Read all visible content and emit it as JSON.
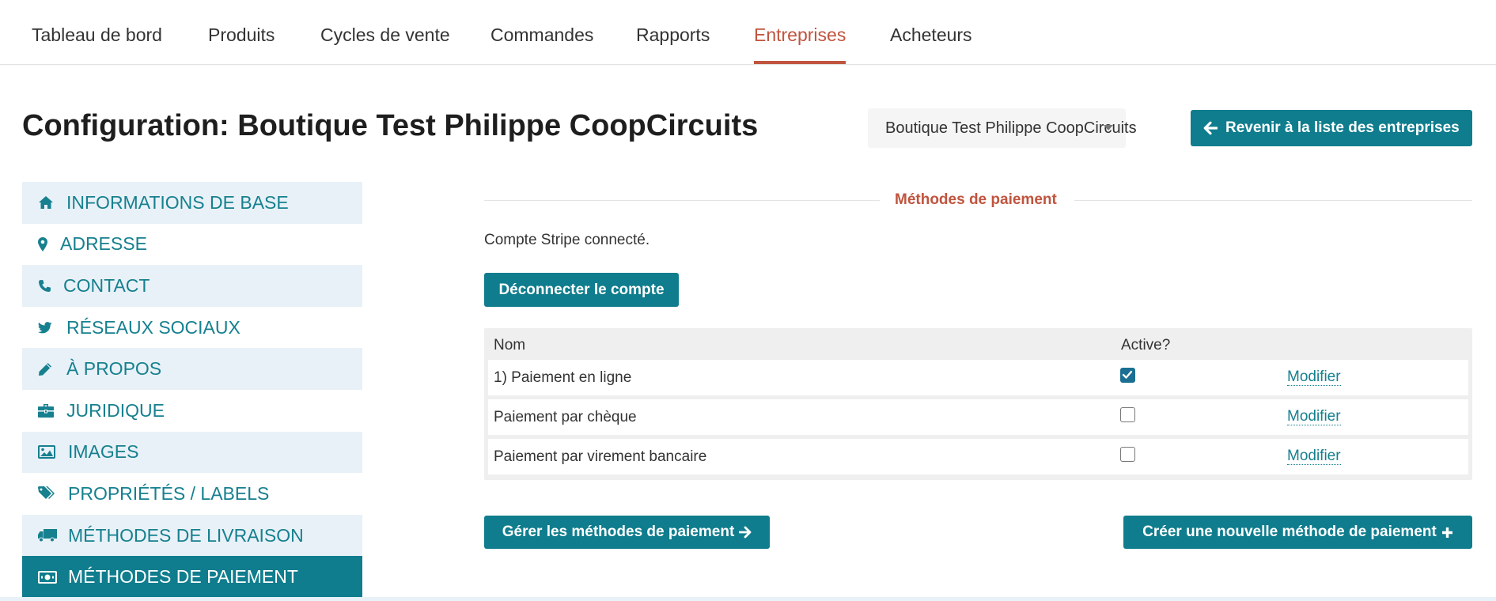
{
  "nav": {
    "tabs": [
      {
        "label": "Tableau de bord"
      },
      {
        "label": "Produits"
      },
      {
        "label": "Cycles de vente"
      },
      {
        "label": "Commandes"
      },
      {
        "label": "Rapports"
      },
      {
        "label": "Entreprises",
        "active": true
      },
      {
        "label": "Acheteurs"
      }
    ],
    "accent_color": "#c0543e"
  },
  "header": {
    "title": "Configuration: Boutique Test Philippe CoopCircuits",
    "company_select": "Boutique Test Philippe CoopCircuits",
    "back_button": "Revenir à la liste des entreprises"
  },
  "sidebar": {
    "items": [
      {
        "label": "INFORMATIONS DE BASE",
        "icon": "home-icon"
      },
      {
        "label": "ADRESSE",
        "icon": "map-marker-icon"
      },
      {
        "label": "CONTACT",
        "icon": "phone-icon"
      },
      {
        "label": "RÉSEAUX SOCIAUX",
        "icon": "twitter-icon"
      },
      {
        "label": "À PROPOS",
        "icon": "pencil-icon"
      },
      {
        "label": "JURIDIQUE",
        "icon": "briefcase-icon"
      },
      {
        "label": "IMAGES",
        "icon": "image-icon"
      },
      {
        "label": "PROPRIÉTÉS / LABELS",
        "icon": "tags-icon"
      },
      {
        "label": "MÉTHODES DE LIVRAISON",
        "icon": "truck-icon"
      },
      {
        "label": "MÉTHODES DE PAIEMENT",
        "icon": "money-icon",
        "active": true
      }
    ],
    "primary_color": "#0f7d8d"
  },
  "content": {
    "section_title": "Méthodes de paiement",
    "status_text": "Compte Stripe connecté.",
    "disconnect_button": "Déconnecter le compte",
    "table": {
      "headers": [
        "Nom",
        "Active?"
      ],
      "rows": [
        {
          "name": "1) Paiement en ligne",
          "active": true,
          "action": "Modifier"
        },
        {
          "name": "Paiement par chèque",
          "active": false,
          "action": "Modifier"
        },
        {
          "name": "Paiement par virement bancaire",
          "active": false,
          "action": "Modifier"
        }
      ]
    },
    "manage_button": "Gérer les méthodes de paiement",
    "create_button": "Créer une nouvelle méthode de paiement"
  }
}
